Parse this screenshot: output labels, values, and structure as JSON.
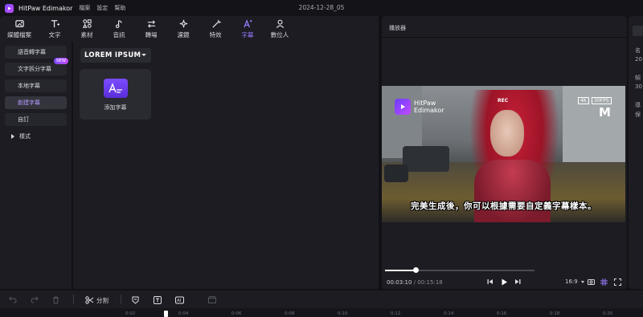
{
  "app": {
    "name": "HitPaw Edimakor",
    "menu": [
      "檔案",
      "設定",
      "幫助"
    ],
    "project_title": "2024-12-28_05"
  },
  "toolbar": {
    "tools": [
      {
        "label": "媒體檔案",
        "icon": "media-icon"
      },
      {
        "label": "文字",
        "icon": "text-icon"
      },
      {
        "label": "素材",
        "icon": "elements-icon"
      },
      {
        "label": "音訊",
        "icon": "audio-icon"
      },
      {
        "label": "轉場",
        "icon": "transition-icon"
      },
      {
        "label": "濾鏡",
        "icon": "filter-icon"
      },
      {
        "label": "特效",
        "icon": "effects-icon"
      },
      {
        "label": "字幕",
        "icon": "subtitle-icon",
        "active": true
      },
      {
        "label": "數位人",
        "icon": "avatar-icon"
      }
    ],
    "active_color": "#9b7bff"
  },
  "sidebar": {
    "items": [
      {
        "label": "語音轉字幕"
      },
      {
        "label": "文字拆分字幕",
        "badge": "NEW"
      },
      {
        "label": "本地字幕"
      },
      {
        "label": "創建字幕",
        "active": true
      },
      {
        "label": "自訂"
      },
      {
        "label": "樣式",
        "group": true
      }
    ]
  },
  "content": {
    "font_select": "LOREM IPSUM",
    "card_label": "添加字幕"
  },
  "player": {
    "title": "播放器",
    "overlay_logo_text_1": "HitPaw",
    "overlay_logo_text_2": "Edimakor",
    "rec": "REC",
    "res_badge": "4K",
    "fps_badge": "30FPS",
    "mode_badge": "M",
    "subtitle_text": "完美生成後，你可以根據需要自定義字幕樣本。",
    "current_time": "00:03:10",
    "separator": "/",
    "total_time": "00:15:18",
    "progress": 0.207,
    "aspect_ratio": "16:9"
  },
  "inspector": {
    "labels": [
      "名",
      "20",
      "幀",
      "30",
      "導",
      "保"
    ]
  },
  "timeline": {
    "split_label": "分割",
    "ruler_ticks": [
      "0:02",
      "0:04",
      "0:06",
      "0:08",
      "0:10",
      "0:12",
      "0:14",
      "0:16",
      "0:18",
      "0:20"
    ]
  }
}
